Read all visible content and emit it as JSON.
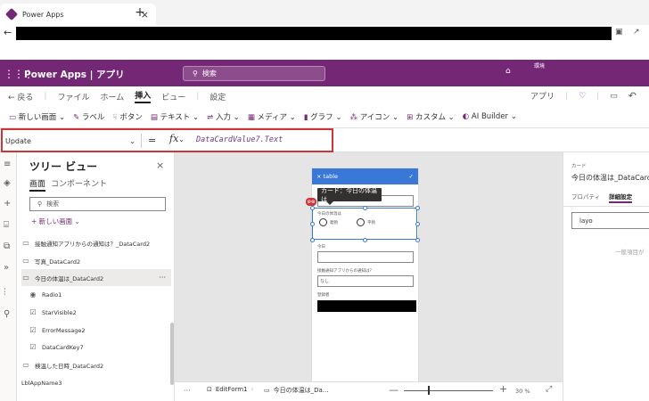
{
  "browser": {
    "tab_title": "Power Apps",
    "tab_close": "×",
    "new_tab": "+",
    "back": "←"
  },
  "header": {
    "app_title": "Power Apps | アプリ",
    "search_placeholder": "検索",
    "env_label": "環境"
  },
  "menu": {
    "back": "← 戻る",
    "items": [
      "ファイル",
      "ホーム",
      "挿入",
      "ビュー",
      "設定"
    ],
    "selected": "挿入",
    "app_label": "アプリ"
  },
  "insert_bar": {
    "items": [
      "新しい画面",
      "ラベル",
      "ボタン",
      "テキスト",
      "入力",
      "メディア",
      "グラフ",
      "アイコン",
      "カスタム",
      "AI Builder"
    ]
  },
  "formula_bar": {
    "property": "Update",
    "eq": "=",
    "fx": "fx",
    "formula": "DataCardValue7.Text"
  },
  "tree_view": {
    "title": "ツリー ビュー",
    "close": "×",
    "tabs": [
      "画面",
      "コンポーネント"
    ],
    "search_placeholder": "検索",
    "new_screen": "+ 新しい画面",
    "items": [
      {
        "label": "接触通知アプリからの通知は？_DataCard2",
        "icon": "card"
      },
      {
        "label": "写真_DataCard2",
        "icon": "card"
      },
      {
        "label": "今日の体温は_DataCard2",
        "icon": "card",
        "selected": true,
        "more": "···"
      },
      {
        "label": "Radio1",
        "icon": "radio"
      },
      {
        "label": "StarVisible2",
        "icon": "edit"
      },
      {
        "label": "ErrorMessage2",
        "icon": "edit"
      },
      {
        "label": "DataCardKey7",
        "icon": "edit"
      },
      {
        "label": "検温した日時_DataCard2",
        "icon": "card"
      },
      {
        "label": "LblAppName3",
        "icon": "none"
      }
    ]
  },
  "canvas": {
    "form_title": "table",
    "form_check": "✓",
    "form_close": "×",
    "tooltip": "カード：今日の体温は",
    "error_badge": "⊗⊗",
    "field_temp_label": "今日の体温は",
    "radio_options": [
      "発熱",
      "平熱"
    ],
    "field_today_label": "今日",
    "field_notice_label": "接触通知アプリからの通知は？",
    "field_notice_value": "なし",
    "field_registrant_label": "登録者"
  },
  "status_bar": {
    "dots": "···",
    "crumb_form": "EditForm1",
    "crumb_card": "今日の体温は_Da...",
    "zoom_minus": "—",
    "zoom_plus": "+",
    "zoom": "30 %",
    "zoom_fraction": 0.3
  },
  "right_panel": {
    "type": "カード",
    "title": "今日の体温は_DataCard",
    "tabs": [
      "プロパティ",
      "詳細設定"
    ],
    "search_value": "layo",
    "note": "一般項目が"
  }
}
